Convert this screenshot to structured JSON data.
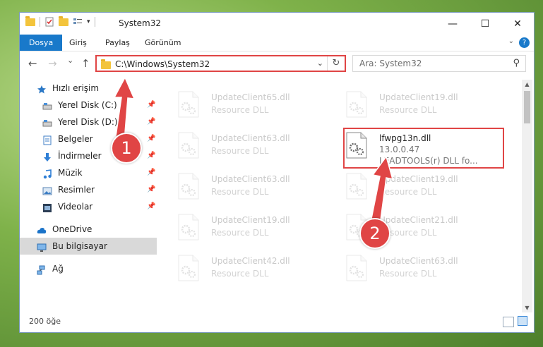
{
  "window": {
    "title": "System32",
    "minimize": "—",
    "maximize": "☐",
    "close": "✕"
  },
  "ribbon": {
    "tabs": [
      "Dosya",
      "Giriş",
      "Paylaş",
      "Görünüm"
    ],
    "help": "?"
  },
  "nav": {
    "back": "←",
    "forward": "→",
    "recent": "⌄",
    "up": "↑",
    "address": "C:\\Windows\\System32",
    "address_dropdown": "⌄",
    "refresh": "↻",
    "search_placeholder": "Ara: System32"
  },
  "sidebar": {
    "items": [
      {
        "label": "Hızlı erişim",
        "icon": "star-icon",
        "pinned": false
      },
      {
        "label": "Yerel Disk (C:)",
        "icon": "drive-icon",
        "pinned": true
      },
      {
        "label": "Yerel Disk (D:)",
        "icon": "drive-icon",
        "pinned": true
      },
      {
        "label": "Belgeler",
        "icon": "documents-icon",
        "pinned": true
      },
      {
        "label": "İndirmeler",
        "icon": "download-icon",
        "pinned": true
      },
      {
        "label": "Müzik",
        "icon": "music-icon",
        "pinned": true
      },
      {
        "label": "Resimler",
        "icon": "pictures-icon",
        "pinned": true
      },
      {
        "label": "Videolar",
        "icon": "video-icon",
        "pinned": true
      },
      {
        "label": "OneDrive",
        "icon": "cloud-icon",
        "pinned": false
      },
      {
        "label": "Bu bilgisayar",
        "icon": "computer-icon",
        "pinned": false
      },
      {
        "label": "Ağ",
        "icon": "network-icon",
        "pinned": false
      }
    ]
  },
  "files": {
    "left": [
      {
        "name": "UpdateClient65.dll",
        "desc": "Resource DLL"
      },
      {
        "name": "UpdateClient63.dll",
        "desc": "Resource DLL"
      },
      {
        "name": "UpdateClient63.dll",
        "desc": "Resource DLL"
      },
      {
        "name": "UpdateClient19.dll",
        "desc": "Resource DLL"
      },
      {
        "name": "UpdateClient42.dll",
        "desc": "Resource DLL"
      }
    ],
    "right": [
      {
        "name": "UpdateClient19.dll",
        "desc": "Resource DLL"
      },
      {
        "name": "lfwpg13n.dll",
        "version": "13.0.0.47",
        "desc": "LEADTOOLS(r) DLL fo...",
        "highlighted": true
      },
      {
        "name": "UpdateClient19.dll",
        "desc": "Resource DLL"
      },
      {
        "name": "UpdateClient21.dll",
        "desc": "Resource DLL"
      },
      {
        "name": "UpdateClient63.dll",
        "desc": "Resource DLL"
      }
    ]
  },
  "status": {
    "count": "200 öğe"
  },
  "annotations": {
    "step1": "1",
    "step2": "2",
    "color": "#e04545"
  }
}
